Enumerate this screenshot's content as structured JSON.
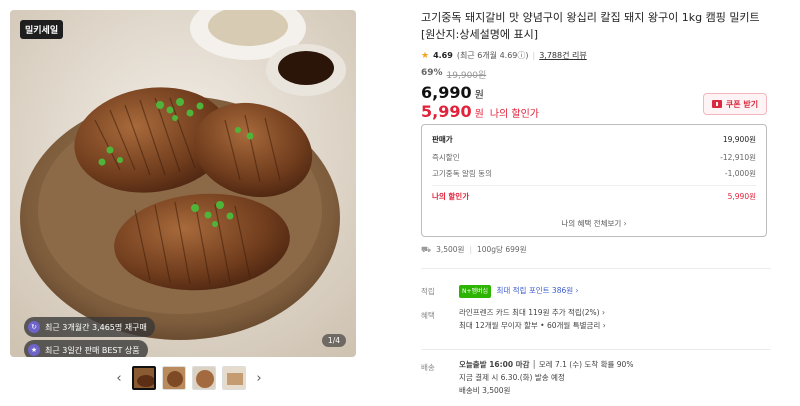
{
  "gallery": {
    "tag": "밀키세일",
    "pill_1": "최근 3개월간 3,465명 재구매",
    "pill_2": "최근 3일간 판매 BEST 상품",
    "counter": "1/4",
    "prev_arrow": "‹",
    "next_arrow": "›",
    "thumb_colors": [
      "#8a5a33",
      "#b98a5c",
      "#a46a3f",
      "#c59c72"
    ]
  },
  "product": {
    "title": "고기중독 돼지갈비 맛 양념구이 왕십리 칼집 돼지 왕구이 1kg 캠핑 밀키트 [원산지:상세설명에 표시]",
    "rating": "4.69",
    "rating_detail": "(최근 6개월 4.69ⓘ)",
    "review_count": "3,788건 리뷰",
    "discount_pct": "69%",
    "original_price": "19,900원",
    "sale_price": "6,990",
    "sale_unit": "원",
    "my_price": "5,990",
    "my_price_unit": "원",
    "my_price_label": "나의 할인가",
    "coupon_label": "쿠폰 받기"
  },
  "price_box": {
    "rows": [
      {
        "label": "판매가",
        "value": "19,900원"
      },
      {
        "label": "즉시할인",
        "value": "-12,910원"
      },
      {
        "label": "고기중독 알림 동의",
        "value": "-1,000원"
      },
      {
        "label": "나의 할인가",
        "value": "5,990원"
      }
    ],
    "more": "나의 혜택 전체보기 ›"
  },
  "unit_price": {
    "weight": "3,500원",
    "per_100g": "100g당 699원"
  },
  "points": {
    "label": "적립",
    "badge": "N+멤버십",
    "text": "최대 적립 포인트 386원 ›"
  },
  "benefits": {
    "label": "혜택",
    "line_1": "라인프렌즈 카드 최대 119원 추가 적립(2%) ›",
    "line_2": "최대 12개월 무이자 할부 • 60개월 특별금리 ›"
  },
  "shipping": {
    "label": "배송",
    "line_1_bold": "오늘출발 16:00 마감",
    "line_1_rest": " │ 모레 7.1 (수) 도착 확률 90%",
    "line_2": "지금 결제 시 6.30.(화) 발송 예정",
    "line_3": "배송비 3,500원"
  },
  "colors": {
    "accent_red": "#e1223a",
    "star": "#f2a31b",
    "points_green": "#2db400",
    "link_blue": "#3d5ccc"
  }
}
